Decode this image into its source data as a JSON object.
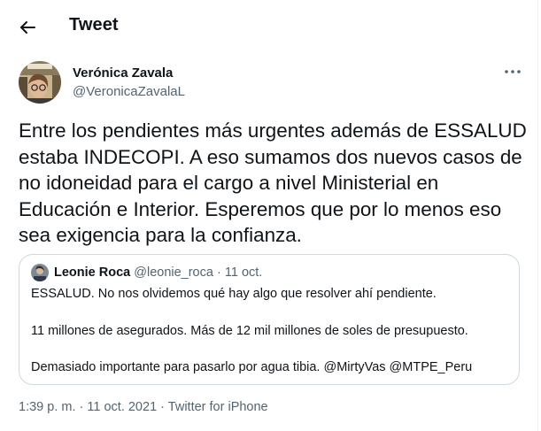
{
  "header": {
    "title": "Tweet"
  },
  "tweet": {
    "author_name": "Verónica Zavala",
    "author_handle": "@VeronicaZavalaL",
    "text": "Entre los pendientes más urgentes además de ESSALUD estaba INDECOPI. A eso sumamos dos nuevos casos de no idoneidad para el cargo a nivel Ministerial en Educación e Interior. Esperemos que por lo menos eso sea exigencia para la confianza.",
    "time": "1:39 p. m.",
    "separator": "·",
    "date": "11 oct. 2021",
    "source": "Twitter for iPhone"
  },
  "quote": {
    "author_name": "Leonie Roca",
    "author_handle": "@leonie_roca",
    "separator": "·",
    "date": "11 oct.",
    "lines": [
      "ESSALUD. No nos olvidemos qué hay algo que resolver ahí pendiente.",
      "11 millones de asegurados. Más de 12 mil millones de soles de presupuesto.",
      "Demasiado importante para pasarlo por agua tibia. @MirtyVas @MTPE_Peru"
    ]
  },
  "colors": {
    "text": "#0f1419",
    "secondary": "#536471",
    "border": "#cfd9de",
    "background": "#ffffff"
  },
  "icons": {
    "back": "arrow-left-icon",
    "more": "more-horizontal-icon"
  }
}
